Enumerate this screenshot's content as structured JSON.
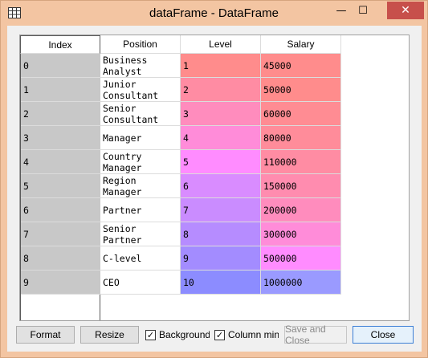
{
  "window": {
    "title": "dataFrame - DataFrame",
    "minimize_glyph": "—",
    "maximize_glyph": "☐",
    "close_glyph": "✕",
    "app_icon": "grid-icon"
  },
  "table": {
    "columns": [
      "Index",
      "Position",
      "Level",
      "Salary"
    ],
    "rows": [
      {
        "index": "0",
        "position": "Business\nAnalyst",
        "level": "1",
        "salary": "45000",
        "level_bg": "#ff8c8c",
        "salary_bg": "#ff8c8c"
      },
      {
        "index": "1",
        "position": "Junior\nConsultant",
        "level": "2",
        "salary": "50000",
        "level_bg": "#ff8ca3",
        "salary_bg": "#ff8c8c"
      },
      {
        "index": "2",
        "position": "Senior\nConsultant",
        "level": "3",
        "salary": "60000",
        "level_bg": "#ff8cbd",
        "salary_bg": "#ff8c93"
      },
      {
        "index": "3",
        "position": "Manager",
        "level": "4",
        "salary": "80000",
        "level_bg": "#ff8cd9",
        "salary_bg": "#ff8c9a"
      },
      {
        "index": "4",
        "position": "Country\nManager",
        "level": "5",
        "salary": "110000",
        "level_bg": "#ff8cff",
        "salary_bg": "#ff8ca3"
      },
      {
        "index": "5",
        "position": "Region\nManager",
        "level": "6",
        "salary": "150000",
        "level_bg": "#d98cff",
        "salary_bg": "#ff8caf"
      },
      {
        "index": "6",
        "position": "Partner",
        "level": "7",
        "salary": "200000",
        "level_bg": "#ca8cff",
        "salary_bg": "#ff8cbd"
      },
      {
        "index": "7",
        "position": "Senior\nPartner",
        "level": "8",
        "salary": "300000",
        "level_bg": "#b68cff",
        "salary_bg": "#ff8cd9"
      },
      {
        "index": "8",
        "position": "C-level",
        "level": "9",
        "salary": "500000",
        "level_bg": "#a38cff",
        "salary_bg": "#ff8cff"
      },
      {
        "index": "9",
        "position": "CEO",
        "level": "10",
        "salary": "1000000",
        "level_bg": "#8c8cff",
        "salary_bg": "#9a9aff"
      }
    ]
  },
  "buttons": {
    "format": "Format",
    "resize": "Resize",
    "background_label": "Background c",
    "background_checked": true,
    "column_minmax_label": "Column min/m",
    "column_minmax_checked": true,
    "save_and_close": "Save and Close",
    "close": "Close"
  }
}
